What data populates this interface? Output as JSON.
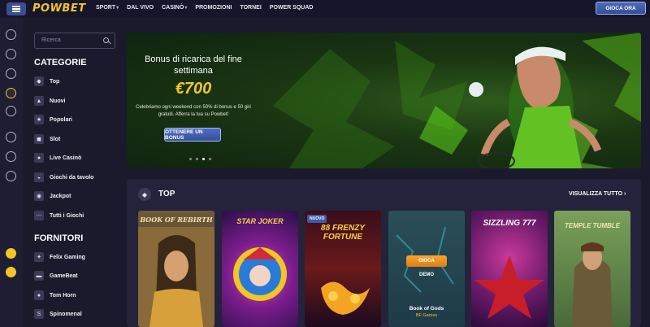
{
  "header": {
    "logo": "POWBET",
    "nav": [
      {
        "label": "SPORT",
        "caret": "▾"
      },
      {
        "label": "DAL VIVO",
        "caret": ""
      },
      {
        "label": "CASINÒ",
        "caret": "▾"
      },
      {
        "label": "PROMOZIONI",
        "caret": ""
      },
      {
        "label": "TORNEI",
        "caret": ""
      },
      {
        "label": "POWER SQUAD",
        "caret": ""
      }
    ],
    "cta": "GIOCA ORA"
  },
  "search": {
    "placeholder": "Ricerca"
  },
  "categories": {
    "title": "CATEGORIE",
    "items": [
      {
        "label": "Top",
        "icon": "◆"
      },
      {
        "label": "Nuovi",
        "icon": "▲"
      },
      {
        "label": "Popolari",
        "icon": "★"
      },
      {
        "label": "Slot",
        "icon": "◼"
      },
      {
        "label": "Live Casinò",
        "icon": "●"
      },
      {
        "label": "Giochi da tavolo",
        "icon": "◒"
      },
      {
        "label": "Jackpot",
        "icon": "◉"
      },
      {
        "label": "Tutti i Giochi",
        "icon": "⋯"
      }
    ]
  },
  "providers": {
    "title": "FORNITORI",
    "items": [
      {
        "label": "Felix Gaming",
        "icon": "✦"
      },
      {
        "label": "GameBeat",
        "icon": "▬"
      },
      {
        "label": "Tom Horn",
        "icon": "●"
      },
      {
        "label": "Spinomenal",
        "icon": "S"
      }
    ]
  },
  "banner": {
    "title": "Bonus di ricarica del fine settimana",
    "amount": "€700",
    "description": "Celebriamo ogni weekend con 50% di bonus e 50 giri gratuiti. Afferra la tua su Powbet!",
    "cta": "OTTENERE UN BONUS",
    "slides": 4,
    "active_slide": 3
  },
  "top_section": {
    "title": "TOP",
    "see_all": "VISUALIZZA TUTTO ›"
  },
  "games": [
    {
      "title": "BOOK OF REBIRTH",
      "badge": ""
    },
    {
      "title": "STAR JOKER",
      "badge": ""
    },
    {
      "title": "88 FRENZY FORTUNE",
      "badge": "NUOVO"
    },
    {
      "title": "",
      "badge": "",
      "hover": {
        "play": "GIOCA",
        "demo": "DEMO",
        "name": "Book of Gods",
        "provider": "BF Games"
      }
    },
    {
      "title": "SIZZLING 777",
      "badge": ""
    },
    {
      "title": "TEMPLE TUMBLE",
      "badge": ""
    }
  ],
  "colors": {
    "accent": "#f3c623",
    "button": "#3a55a0",
    "bg": "#1b1a2c",
    "panel": "#24233b"
  }
}
